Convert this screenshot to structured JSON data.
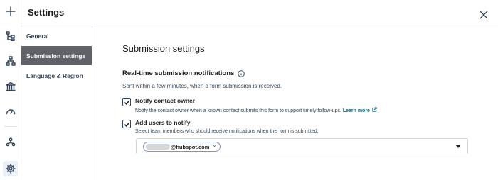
{
  "header": {
    "title": "Settings"
  },
  "rail": {
    "icons": [
      "plus-icon",
      "workflow-icon",
      "hierarchy-icon",
      "bank-icon",
      "speedometer-icon",
      "people-icon",
      "gear-icon"
    ]
  },
  "subnav": {
    "items": [
      {
        "label": "General",
        "active": false
      },
      {
        "label": "Submission settings",
        "active": true
      },
      {
        "label": "Language & Region",
        "active": false
      }
    ]
  },
  "main": {
    "title": "Submission settings",
    "notifications": {
      "heading": "Real-time submission notifications",
      "description": "Sent within a few minutes, when a form submission is received.",
      "notify_owner": {
        "label": "Notify contact owner",
        "checked": true,
        "help": "Notify the contact owner when a known contact submits this form to support timely follow-ups.",
        "link": "Learn more"
      },
      "add_users": {
        "label": "Add users to notify",
        "checked": true,
        "help": "Select team members who should receive notifications when this form is submitted."
      },
      "users_select": {
        "chip_text": "@hubspot.com",
        "chip_remove": "×"
      }
    }
  }
}
